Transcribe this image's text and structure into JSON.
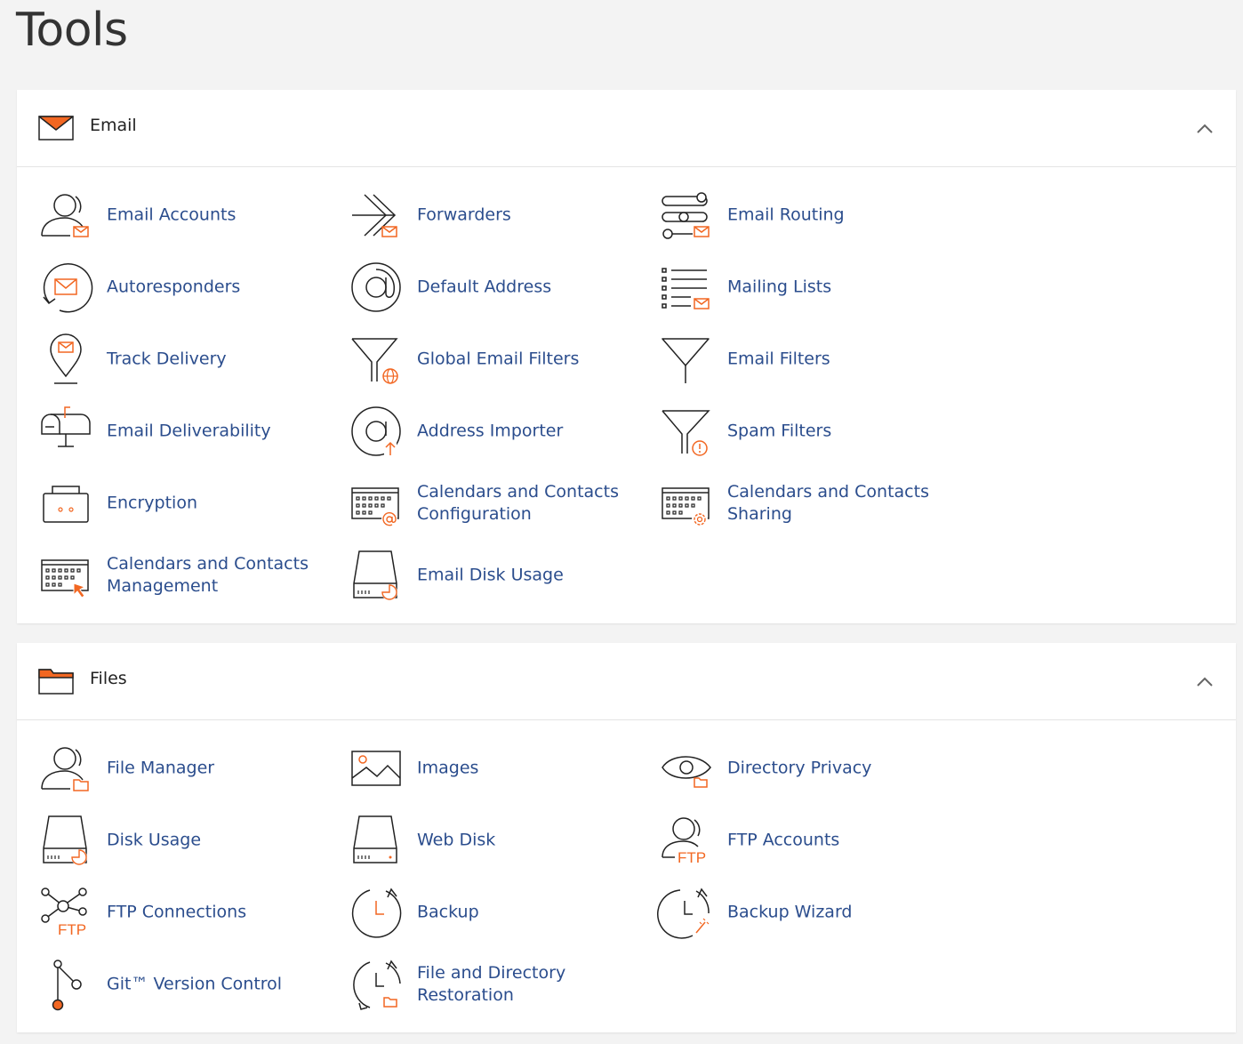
{
  "page": {
    "title": "Tools"
  },
  "colors": {
    "link": "#2b4d8d",
    "accent": "#f26722",
    "icon": "#222222"
  },
  "email": {
    "title": "Email",
    "header_icon": "envelope-icon",
    "items": [
      {
        "label": "Email Accounts",
        "icon": "user-mail-icon"
      },
      {
        "label": "Forwarders",
        "icon": "forward-arrow-icon"
      },
      {
        "label": "Email Routing",
        "icon": "routing-icon"
      },
      {
        "label": "Autoresponders",
        "icon": "autoresponder-icon"
      },
      {
        "label": "Default Address",
        "icon": "at-sign-icon"
      },
      {
        "label": "Mailing Lists",
        "icon": "list-mail-icon"
      },
      {
        "label": "Track Delivery",
        "icon": "map-pin-mail-icon"
      },
      {
        "label": "Global Email Filters",
        "icon": "funnel-globe-icon"
      },
      {
        "label": "Email Filters",
        "icon": "funnel-icon"
      },
      {
        "label": "Email Deliverability",
        "icon": "mailbox-icon"
      },
      {
        "label": "Address Importer",
        "icon": "at-import-icon"
      },
      {
        "label": "Spam Filters",
        "icon": "funnel-warning-icon"
      },
      {
        "label": "Encryption",
        "icon": "key-box-icon"
      },
      {
        "label": "Calendars and Contacts Configuration",
        "icon": "calendar-at-icon"
      },
      {
        "label": "Calendars and Contacts Sharing",
        "icon": "calendar-gear-icon"
      },
      {
        "label": "Calendars and Contacts Management",
        "icon": "calendar-cursor-icon"
      },
      {
        "label": "Email Disk Usage",
        "icon": "disk-chart-icon"
      }
    ]
  },
  "files": {
    "title": "Files",
    "header_icon": "folder-icon",
    "items": [
      {
        "label": "File Manager",
        "icon": "user-folder-icon"
      },
      {
        "label": "Images",
        "icon": "image-icon"
      },
      {
        "label": "Directory Privacy",
        "icon": "eye-folder-icon"
      },
      {
        "label": "Disk Usage",
        "icon": "disk-chart-icon"
      },
      {
        "label": "Web Disk",
        "icon": "disk-icon"
      },
      {
        "label": "FTP Accounts",
        "icon": "user-ftp-icon",
        "badge": "FTP"
      },
      {
        "label": "FTP Connections",
        "icon": "network-ftp-icon",
        "badge": "FTP"
      },
      {
        "label": "Backup",
        "icon": "clock-backup-icon"
      },
      {
        "label": "Backup Wizard",
        "icon": "clock-wand-icon"
      },
      {
        "label": "Git™ Version Control",
        "icon": "git-branch-icon"
      },
      {
        "label": "File and Directory Restoration",
        "icon": "clock-restore-folder-icon"
      }
    ]
  }
}
